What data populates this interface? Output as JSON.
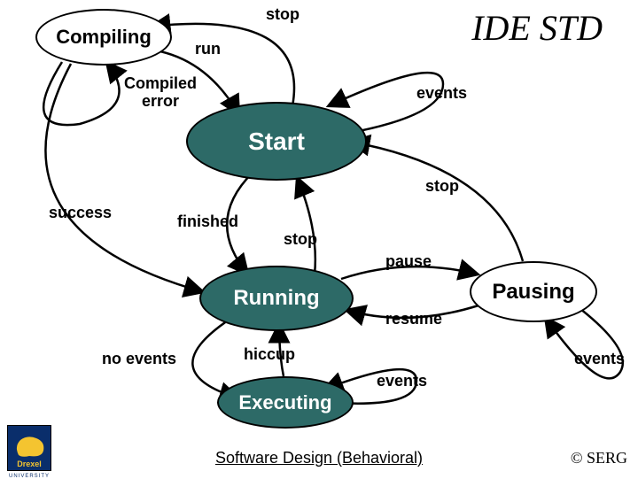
{
  "title": "IDE STD",
  "states": {
    "compiling": "Compiling",
    "start": "Start",
    "running": "Running",
    "pausing": "Pausing",
    "executing": "Executing"
  },
  "transitions": {
    "stop_top": "stop",
    "run": "run",
    "compiled_error": "Compiled\nerror",
    "events_top": "events",
    "success": "success",
    "finished": "finished",
    "stop_right": "stop",
    "stop_mid": "stop",
    "pause": "pause",
    "resume": "resume",
    "no_events": "no events",
    "hiccup": "hiccup",
    "events_bottom": "events",
    "events_right": "events"
  },
  "footer": "Software Design (Behavioral)",
  "copyright": "© SERG",
  "logo": {
    "main": "Drexel",
    "sub": "UNIVERSITY"
  }
}
